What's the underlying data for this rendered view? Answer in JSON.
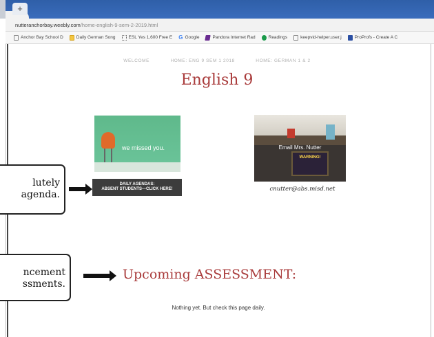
{
  "browser": {
    "new_tab_glyph": "+",
    "url_domain": "nutteranchorbay.weebly.com",
    "url_path": "/home-english-9-sem-2-2019.html",
    "bookmarks": [
      {
        "label": "Anchor Bay School D",
        "icon": "page-icon"
      },
      {
        "label": "Daily German Song",
        "icon": "folder-icon"
      },
      {
        "label": "ESL Yes 1,600 Free E",
        "icon": "grid-icon"
      },
      {
        "label": "Google",
        "icon": "google-icon"
      },
      {
        "label": "Pandora Internet Rad",
        "icon": "pandora-icon"
      },
      {
        "label": "Readings",
        "icon": "readings-icon"
      },
      {
        "label": "keepvid-helper.user.j",
        "icon": "page-icon"
      },
      {
        "label": "ProProfs - Create A C",
        "icon": "proprofs-icon"
      }
    ]
  },
  "site": {
    "nav": [
      "WELCOME",
      "HOME: ENG 9 SEM 1 2018",
      "HOME: GERMAN 1 & 2"
    ],
    "title": "English 9",
    "missed_text": "we missed you.",
    "agenda_button_line1": "DAILY AGENDAS:",
    "agenda_button_line2": "ABSENT STUDENTS---CLICK HERE!",
    "email_label": "Email Mrs. Nutter",
    "sign_text": "WARNING!",
    "email_address": "cnutter@abs.misd.net",
    "assessment_heading": "Upcoming ASSESSMENT:",
    "assessment_note": "Nothing yet.  But check this page daily."
  },
  "annotations": {
    "callout1_line1": "lutely",
    "callout1_line2": "agenda.",
    "callout2_line1": "ncement",
    "callout2_line2": "ssments."
  },
  "colors": {
    "accent_red": "#a93b3b",
    "tab_blue": "#2f5fa8",
    "button_dark": "#3c3c3c"
  }
}
